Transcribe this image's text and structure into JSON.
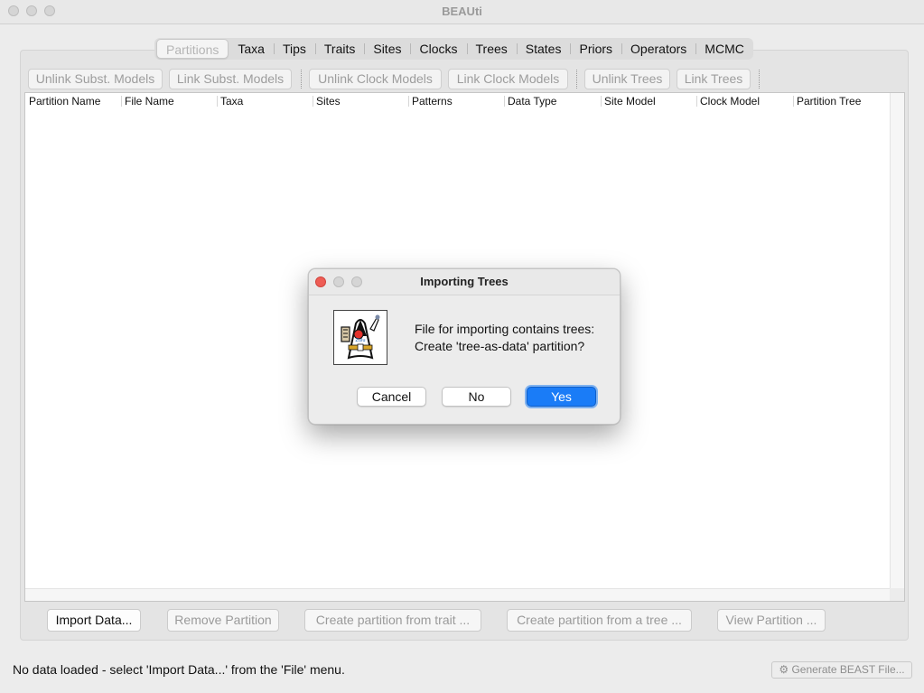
{
  "window": {
    "title": "BEAUti"
  },
  "tabs": [
    "Partitions",
    "Taxa",
    "Tips",
    "Traits",
    "Sites",
    "Clocks",
    "Trees",
    "States",
    "Priors",
    "Operators",
    "MCMC"
  ],
  "selected_tab": "Partitions",
  "toolbar": {
    "unlink_subst": "Unlink Subst. Models",
    "link_subst": "Link Subst. Models",
    "unlink_clock": "Unlink Clock Models",
    "link_clock": "Link Clock Models",
    "unlink_trees": "Unlink Trees",
    "link_trees": "Link Trees"
  },
  "table": {
    "columns": [
      "Partition Name",
      "File Name",
      "Taxa",
      "Sites",
      "Patterns",
      "Data Type",
      "Site Model",
      "Clock Model",
      "Partition Tree"
    ],
    "rows": []
  },
  "bottom_buttons": {
    "import_data": "Import Data...",
    "remove_partition": "Remove Partition",
    "create_from_trait": "Create partition from trait ...",
    "create_from_tree": "Create partition from a tree ...",
    "view_partition": "View Partition ..."
  },
  "status": {
    "message": "No data loaded - select 'Import Data...' from the 'File' menu.",
    "generate_label": "Generate BEAST File..."
  },
  "dialog": {
    "title": "Importing Trees",
    "message_line1": "File for importing contains trees:",
    "message_line2": "Create 'tree-as-data' partition?",
    "cancel": "Cancel",
    "no": "No",
    "yes": "Yes",
    "icon": "java-duke-icon"
  },
  "colors": {
    "accent": "#1a7cf7",
    "close_red": "#ee5d55"
  }
}
